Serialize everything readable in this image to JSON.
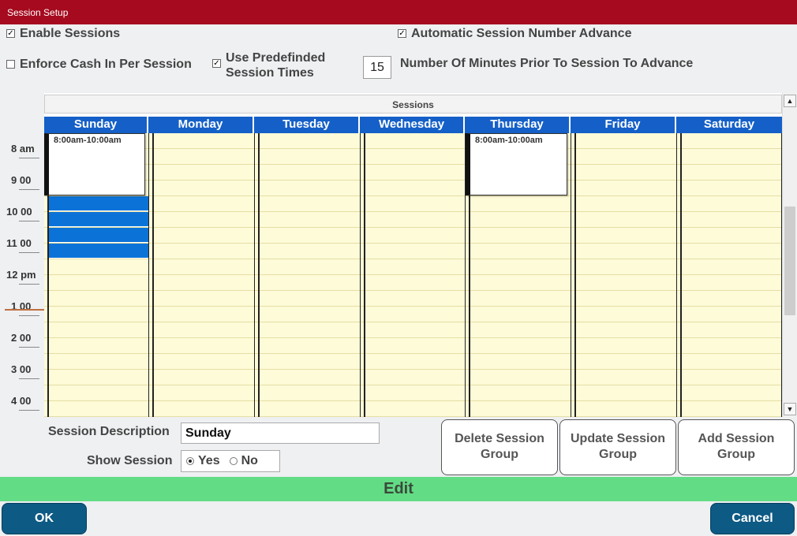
{
  "window": {
    "title": "Session Setup"
  },
  "settings": {
    "enable_sessions": {
      "label": "Enable Sessions",
      "checked": true
    },
    "auto_advance": {
      "label": "Automatic Session Number Advance",
      "checked": true
    },
    "enforce_cash": {
      "label": "Enforce Cash In Per Session",
      "checked": false
    },
    "predefined_times": {
      "label_line1": "Use Predefinded",
      "label_line2": "Session Times",
      "checked": true
    },
    "minutes_prior": {
      "value": "15",
      "label": "Number Of Minutes Prior To Session To Advance"
    }
  },
  "calendar": {
    "header": "Sessions",
    "days": [
      "Sunday",
      "Monday",
      "Tuesday",
      "Wednesday",
      "Thursday",
      "Friday",
      "Saturday"
    ],
    "times": [
      {
        "hour": "8",
        "suffix": "am"
      },
      {
        "hour": "9",
        "suffix": "00"
      },
      {
        "hour": "10",
        "suffix": "00"
      },
      {
        "hour": "11",
        "suffix": "00"
      },
      {
        "hour": "12",
        "suffix": "pm"
      },
      {
        "hour": "1",
        "suffix": "00"
      },
      {
        "hour": "2",
        "suffix": "00"
      },
      {
        "hour": "3",
        "suffix": "00"
      },
      {
        "hour": "4",
        "suffix": "00"
      }
    ],
    "events": [
      {
        "day": "Sunday",
        "label": "8:00am-10:00am"
      },
      {
        "day": "Thursday",
        "label": "8:00am-10:00am"
      }
    ]
  },
  "form": {
    "description_label": "Session Description",
    "description_value": "Sunday",
    "show_label": "Show Session",
    "yes_label": "Yes",
    "no_label": "No",
    "show_selected": "Yes"
  },
  "actions": {
    "delete": {
      "line1": "Delete Session",
      "line2": "Group"
    },
    "update": {
      "line1": "Update Session",
      "line2": "Group"
    },
    "add": {
      "line1": "Add Session",
      "line2": "Group"
    }
  },
  "mode": "Edit",
  "footer": {
    "ok": "OK",
    "cancel": "Cancel"
  },
  "colors": {
    "titlebar": "#a50a1e",
    "day_header": "#1560c8",
    "grid": "#fdfbd8",
    "selection": "#0b73d8",
    "mode_bar": "#63dc86",
    "button": "#0d5a84"
  },
  "icons": {
    "checkbox": "check-mark",
    "scroll_up": "triangle-up",
    "scroll_down": "triangle-down"
  }
}
